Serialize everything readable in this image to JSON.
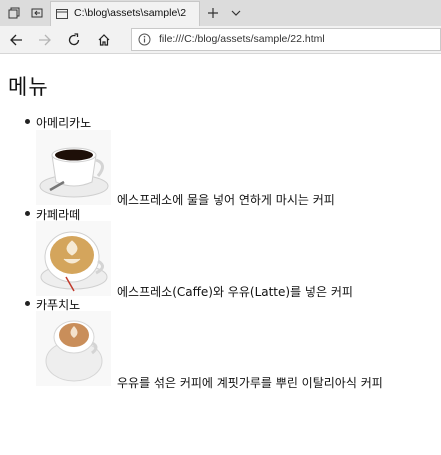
{
  "browser": {
    "tab_title": "C:\\blog\\assets\\sample\\2",
    "address": "file:///C:/blog/assets/sample/22.html",
    "address_icon": "info-icon"
  },
  "page": {
    "heading": "메뉴",
    "items": [
      {
        "name": "아메리카노",
        "description": "에스프레소에 물을 넣어 연하게 마시는 커피",
        "image_icon": "americano-cup-photo"
      },
      {
        "name": "카페라떼",
        "description": "에스프레소(Caffe)와 우유(Latte)를 넣은 커피",
        "image_icon": "cafe-latte-cup-photo"
      },
      {
        "name": "카푸치노",
        "description": "우유를 섞은 커피에 계핏가루를 뿌린 이탈리아식 커피",
        "image_icon": "cappuccino-cup-photo"
      }
    ]
  }
}
